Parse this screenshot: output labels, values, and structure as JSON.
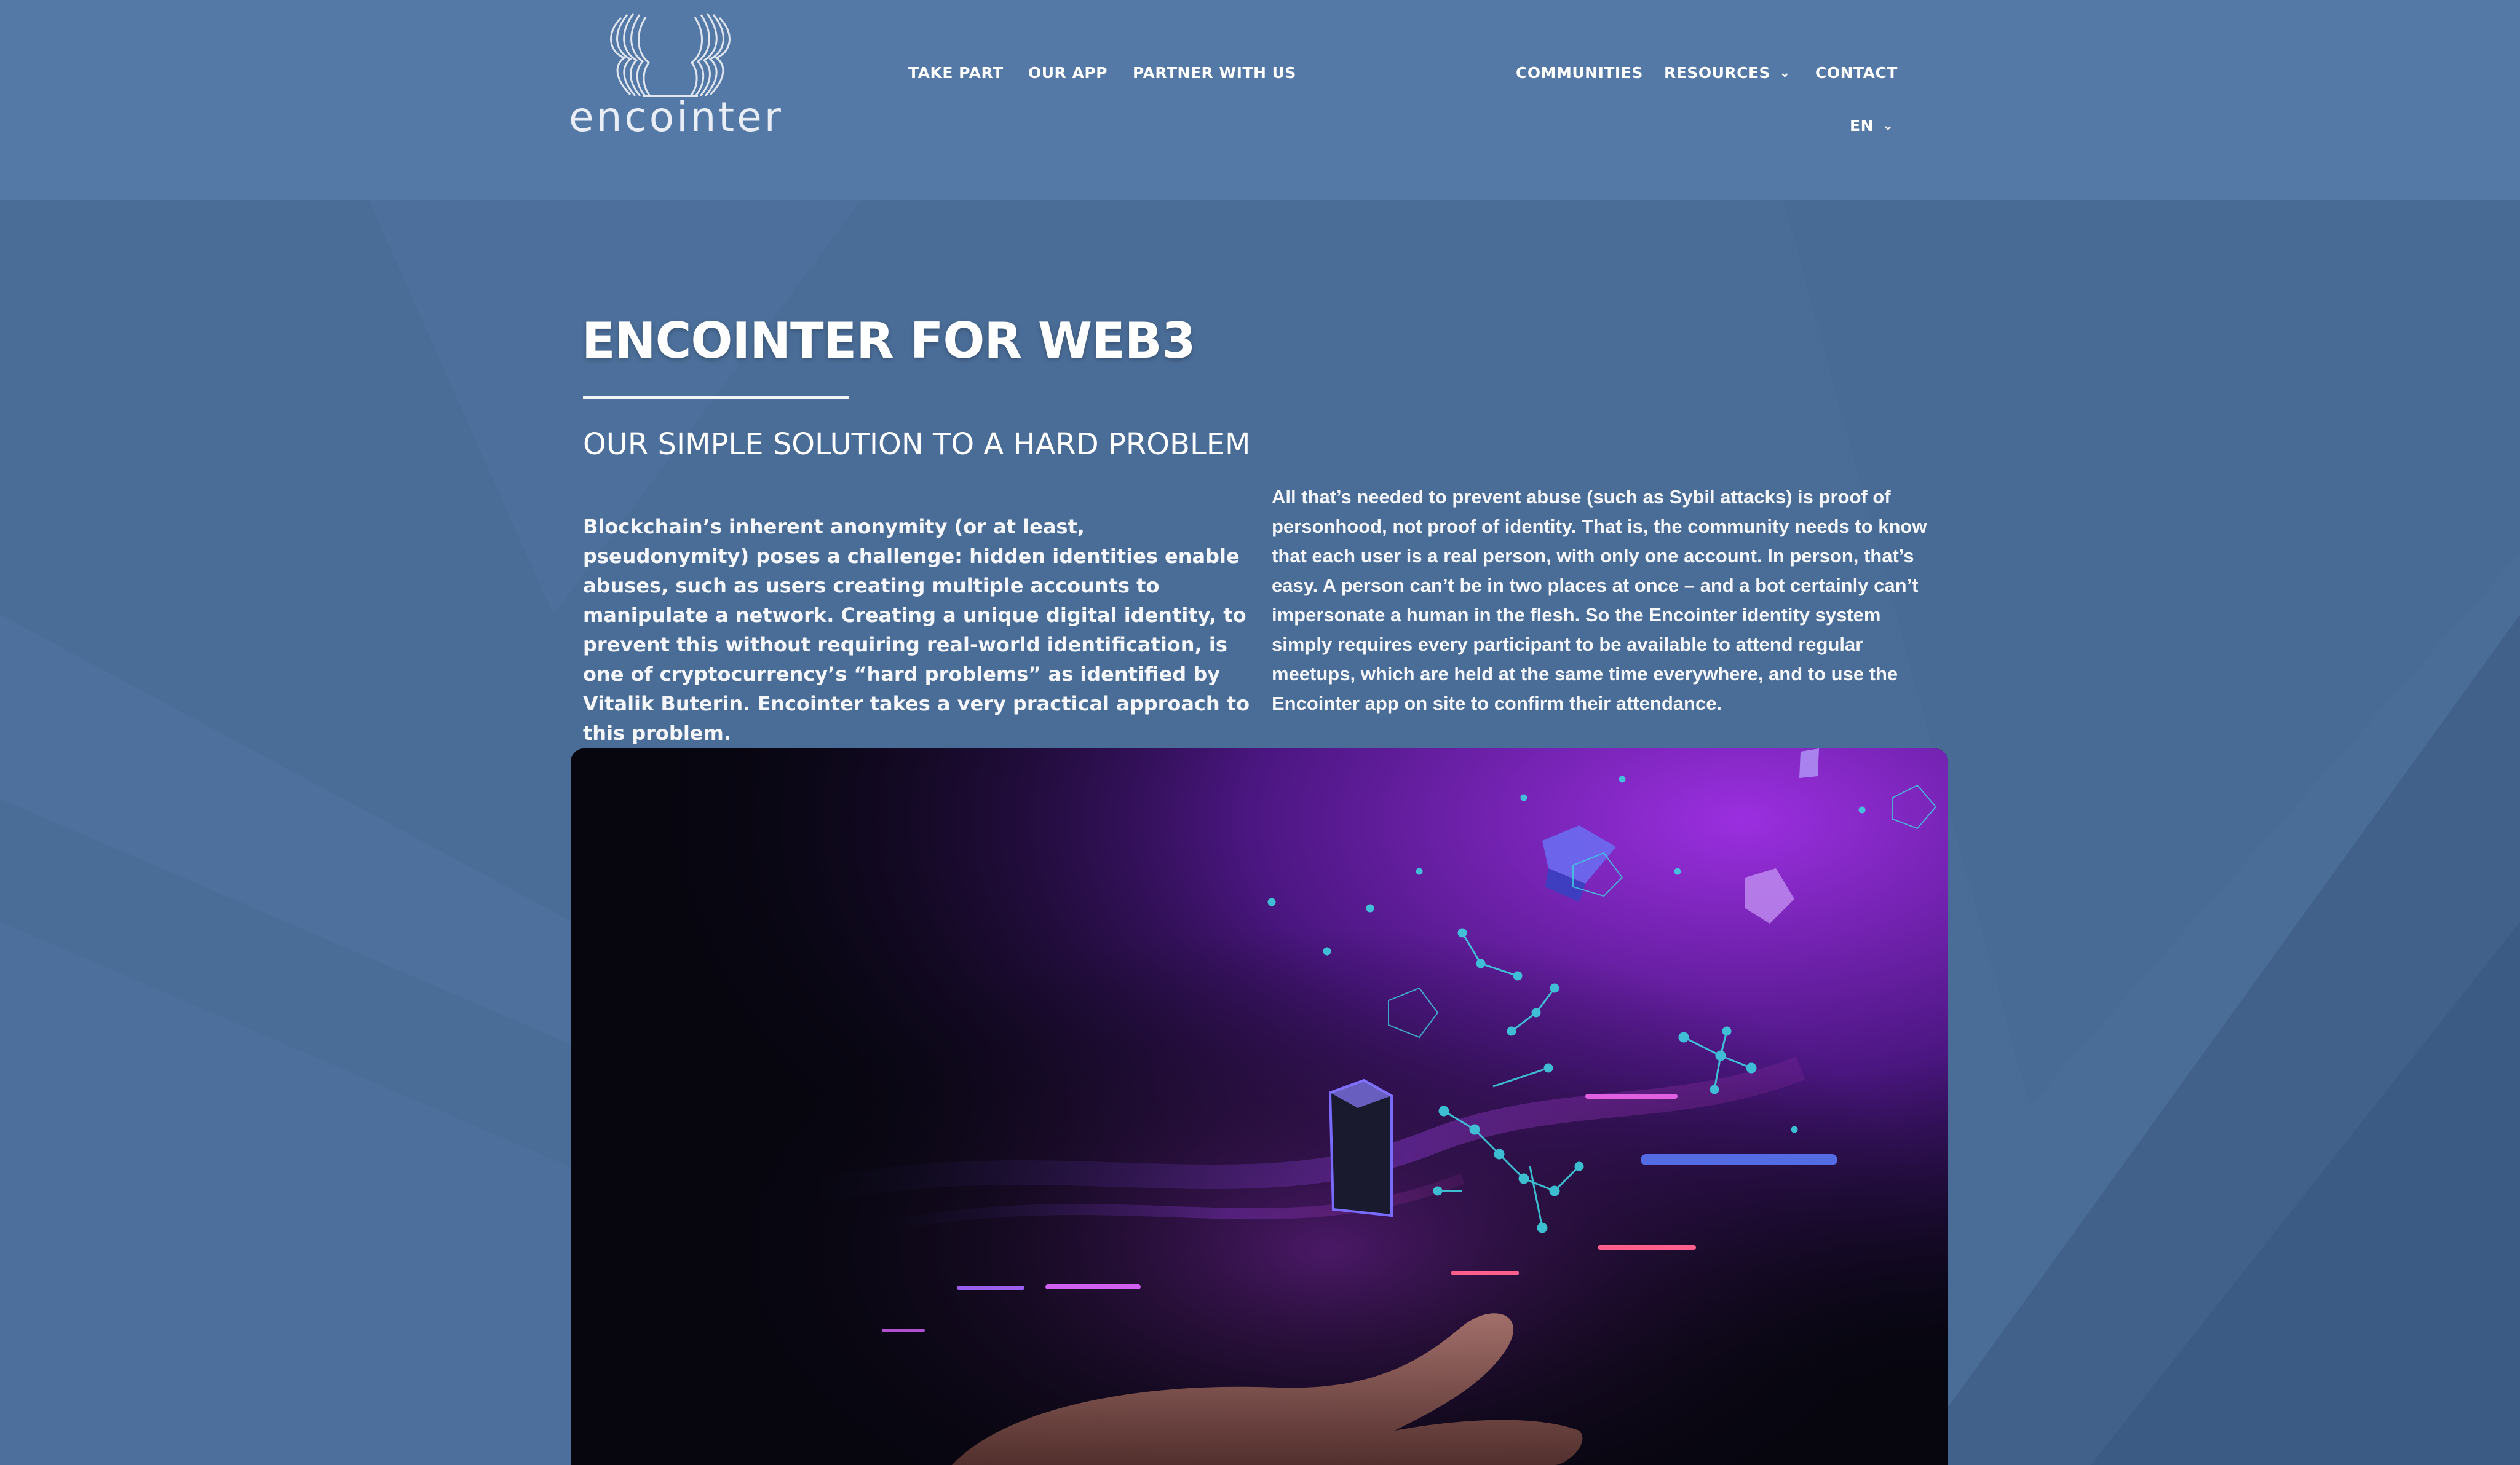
{
  "brand": {
    "logo_text": "encointer",
    "logo_icon": "two-faces-waveform-icon"
  },
  "nav": {
    "primary": [
      {
        "label": "TAKE PART"
      },
      {
        "label": "OUR APP"
      },
      {
        "label": "PARTNER WITH US"
      }
    ],
    "secondary": [
      {
        "label": "COMMUNITIES"
      },
      {
        "label": "RESOURCES"
      },
      {
        "label": "CONTACT"
      }
    ],
    "language": "EN"
  },
  "main": {
    "title": "ENCOINTER FOR WEB3",
    "subtitle": "OUR SIMPLE SOLUTION TO A HARD PROBLEM",
    "paragraph_left": "Blockchain’s inherent anonymity (or at least, pseudonymity) poses a challenge: hidden identities enable abuses, such as users creating multiple accounts to manipulate a network. Creating a unique digital identity, to prevent this without requiring real-world identification, is one of cryptocurrency’s “hard problems” as identified by Vitalik Buterin. Encointer takes a very practical approach to this problem.",
    "paragraph_right": "All that’s needed to prevent abuse (such as Sybil attacks) is proof of personhood, not proof of identity. That is, the community needs to know that each user is a real person, with only one account. In person, that’s easy. A person can’t be in two places at once – and a bot certainly can’t impersonate a human in the flesh. So the Encointer identity system simply requires every participant to be available to attend regular meetups, which are held at the same time everywhere, and to use the Encointer app on site to confirm their attendance."
  },
  "colors": {
    "page_background": "#4a6d98",
    "header_background": "#5579a7",
    "text": "#ffffff",
    "hero_accent_purple": "#8a2bd6",
    "hero_accent_cyan": "#3fd0e0"
  },
  "icons": {
    "dropdown": "chevron-down-icon"
  }
}
